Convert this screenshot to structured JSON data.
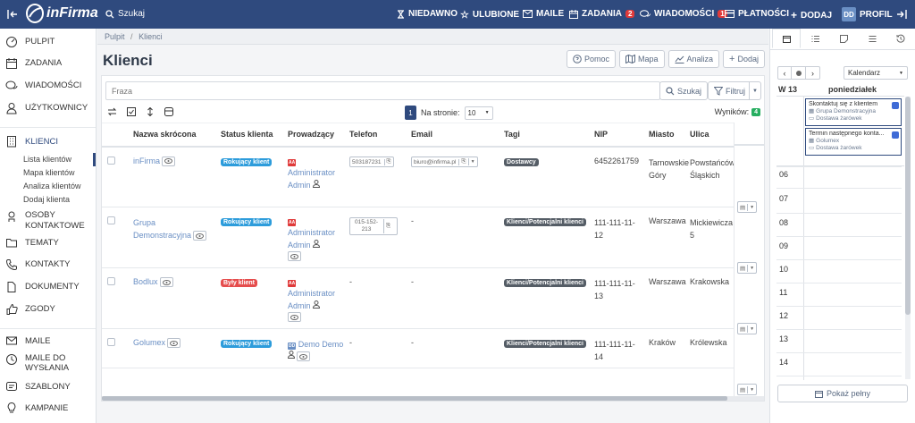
{
  "topbar": {
    "logo_text": "inFirma",
    "search_label": "Szukaj",
    "recent_label": "NIEDAWNO",
    "favorites_label": "ULUBIONE",
    "mail_label": "MAILE",
    "tasks_label": "ZADANIA",
    "tasks_count": "2",
    "messages_label": "WIADOMOŚCI",
    "messages_count": "1",
    "payments_label": "PŁATNOŚCI",
    "add_label": "DODAJ",
    "avatar_initials": "DD",
    "profile_label": "PROFIL"
  },
  "sidebar": {
    "items": [
      {
        "label": "PULPIT"
      },
      {
        "label": "ZADANIA"
      },
      {
        "label": "WIADOMOŚCI"
      },
      {
        "label": "UŻYTKOWNICY"
      },
      {
        "label": "KLIENCI"
      },
      {
        "label": "OSOBY KONTAKTOWE"
      },
      {
        "label": "TEMATY"
      },
      {
        "label": "KONTAKTY"
      },
      {
        "label": "DOKUMENTY"
      },
      {
        "label": "ZGODY"
      },
      {
        "label": "MAILE"
      },
      {
        "label": "MAILE DO WYSŁANIA"
      },
      {
        "label": "SZABLONY"
      },
      {
        "label": "KAMPANIE"
      }
    ],
    "sub": [
      "Lista klientów",
      "Mapa klientów",
      "Analiza klientów",
      "Dodaj klienta"
    ]
  },
  "breadcrumb": {
    "home": "Pulpit",
    "sep": "/",
    "current": "Klienci"
  },
  "page": {
    "title": "Klienci",
    "help": "Pomoc",
    "map": "Mapa",
    "analysis": "Analiza",
    "add": "Dodaj"
  },
  "filter": {
    "placeholder": "Fraza",
    "search": "Szukaj",
    "filter": "Filtruj"
  },
  "toolbar": {
    "page_number": "1",
    "per_page_label": "Na stronie:",
    "per_page_value": "10",
    "results_label": "Wyników:",
    "results_count": "4"
  },
  "table": {
    "headers": [
      "Nazwa skrócona",
      "Status klienta",
      "Prowadzący",
      "Telefon",
      "Email",
      "Tagi",
      "NIP",
      "Miasto",
      "Ulica"
    ],
    "rows": [
      {
        "name": "inFirma",
        "status": "Rokujący klient",
        "status_color": "#2d9cdb",
        "owner_badge": "AA",
        "owner": "Administrator Admin",
        "phone": "503187231",
        "email": "biuro@infirma.pl",
        "tag": "Dostawcy",
        "nip": "6452261759",
        "city": "Tarnowskie Góry",
        "street": "Powstańców Śląskich"
      },
      {
        "name": "Grupa Demonstracyjna",
        "status": "Rokujący klient",
        "status_color": "#2d9cdb",
        "owner_badge": "AA",
        "owner": "Administrator Admin",
        "phone": "015-152-213",
        "email": "-",
        "tag": "Klienci/Potencjalni klienci",
        "nip": "111-111-11-12",
        "city": "Warszawa",
        "street": "Mickiewicza 5"
      },
      {
        "name": "Bodlux",
        "status": "Były klient",
        "status_color": "#e54d4d",
        "owner_badge": "AA",
        "owner": "Administrator Admin",
        "phone": "-",
        "email": "-",
        "tag": "Klienci/Potencjalni klienci",
        "nip": "111-111-11-13",
        "city": "Warszawa",
        "street": "Krakowska"
      },
      {
        "name": "Golumex",
        "status": "Rokujący klient",
        "status_color": "#2d9cdb",
        "owner_badge": "DD",
        "owner": "Demo Demo",
        "phone": "-",
        "email": "-",
        "tag": "Klienci/Potencjalni klienci",
        "nip": "111-111-11-14",
        "city": "Kraków",
        "street": "Królewska"
      }
    ]
  },
  "calendar": {
    "view_select": "Kalendarz",
    "week": "W 13",
    "day": "poniedziałek",
    "events": [
      {
        "title": "Skontaktuj się z klientem",
        "company": "Grupa Demonstracyjna",
        "tag": "Dostawa żarówek"
      },
      {
        "title": "Termin następnego konta...",
        "company": "Golumex",
        "tag": "Dostawa żarówek"
      }
    ],
    "hours": [
      "06",
      "07",
      "08",
      "09",
      "10",
      "11",
      "12",
      "13",
      "14"
    ],
    "show_full": "Pokaż pełny"
  }
}
